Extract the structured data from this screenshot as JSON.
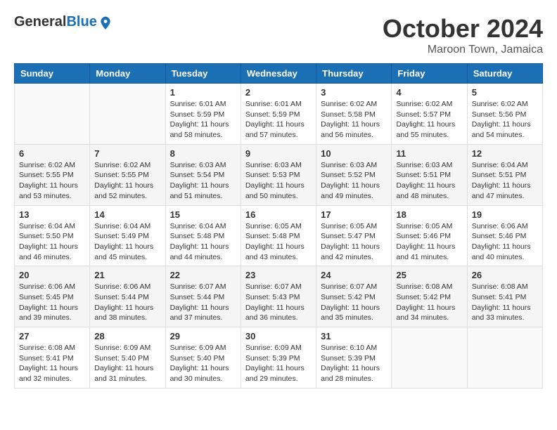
{
  "header": {
    "logo": {
      "general": "General",
      "blue": "Blue"
    },
    "month": "October 2024",
    "location": "Maroon Town, Jamaica"
  },
  "weekdays": [
    "Sunday",
    "Monday",
    "Tuesday",
    "Wednesday",
    "Thursday",
    "Friday",
    "Saturday"
  ],
  "weeks": [
    [
      {
        "day": "",
        "info": ""
      },
      {
        "day": "",
        "info": ""
      },
      {
        "day": "1",
        "info": "Sunrise: 6:01 AM\nSunset: 5:59 PM\nDaylight: 11 hours and 58 minutes."
      },
      {
        "day": "2",
        "info": "Sunrise: 6:01 AM\nSunset: 5:59 PM\nDaylight: 11 hours and 57 minutes."
      },
      {
        "day": "3",
        "info": "Sunrise: 6:02 AM\nSunset: 5:58 PM\nDaylight: 11 hours and 56 minutes."
      },
      {
        "day": "4",
        "info": "Sunrise: 6:02 AM\nSunset: 5:57 PM\nDaylight: 11 hours and 55 minutes."
      },
      {
        "day": "5",
        "info": "Sunrise: 6:02 AM\nSunset: 5:56 PM\nDaylight: 11 hours and 54 minutes."
      }
    ],
    [
      {
        "day": "6",
        "info": "Sunrise: 6:02 AM\nSunset: 5:55 PM\nDaylight: 11 hours and 53 minutes."
      },
      {
        "day": "7",
        "info": "Sunrise: 6:02 AM\nSunset: 5:55 PM\nDaylight: 11 hours and 52 minutes."
      },
      {
        "day": "8",
        "info": "Sunrise: 6:03 AM\nSunset: 5:54 PM\nDaylight: 11 hours and 51 minutes."
      },
      {
        "day": "9",
        "info": "Sunrise: 6:03 AM\nSunset: 5:53 PM\nDaylight: 11 hours and 50 minutes."
      },
      {
        "day": "10",
        "info": "Sunrise: 6:03 AM\nSunset: 5:52 PM\nDaylight: 11 hours and 49 minutes."
      },
      {
        "day": "11",
        "info": "Sunrise: 6:03 AM\nSunset: 5:51 PM\nDaylight: 11 hours and 48 minutes."
      },
      {
        "day": "12",
        "info": "Sunrise: 6:04 AM\nSunset: 5:51 PM\nDaylight: 11 hours and 47 minutes."
      }
    ],
    [
      {
        "day": "13",
        "info": "Sunrise: 6:04 AM\nSunset: 5:50 PM\nDaylight: 11 hours and 46 minutes."
      },
      {
        "day": "14",
        "info": "Sunrise: 6:04 AM\nSunset: 5:49 PM\nDaylight: 11 hours and 45 minutes."
      },
      {
        "day": "15",
        "info": "Sunrise: 6:04 AM\nSunset: 5:48 PM\nDaylight: 11 hours and 44 minutes."
      },
      {
        "day": "16",
        "info": "Sunrise: 6:05 AM\nSunset: 5:48 PM\nDaylight: 11 hours and 43 minutes."
      },
      {
        "day": "17",
        "info": "Sunrise: 6:05 AM\nSunset: 5:47 PM\nDaylight: 11 hours and 42 minutes."
      },
      {
        "day": "18",
        "info": "Sunrise: 6:05 AM\nSunset: 5:46 PM\nDaylight: 11 hours and 41 minutes."
      },
      {
        "day": "19",
        "info": "Sunrise: 6:06 AM\nSunset: 5:46 PM\nDaylight: 11 hours and 40 minutes."
      }
    ],
    [
      {
        "day": "20",
        "info": "Sunrise: 6:06 AM\nSunset: 5:45 PM\nDaylight: 11 hours and 39 minutes."
      },
      {
        "day": "21",
        "info": "Sunrise: 6:06 AM\nSunset: 5:44 PM\nDaylight: 11 hours and 38 minutes."
      },
      {
        "day": "22",
        "info": "Sunrise: 6:07 AM\nSunset: 5:44 PM\nDaylight: 11 hours and 37 minutes."
      },
      {
        "day": "23",
        "info": "Sunrise: 6:07 AM\nSunset: 5:43 PM\nDaylight: 11 hours and 36 minutes."
      },
      {
        "day": "24",
        "info": "Sunrise: 6:07 AM\nSunset: 5:42 PM\nDaylight: 11 hours and 35 minutes."
      },
      {
        "day": "25",
        "info": "Sunrise: 6:08 AM\nSunset: 5:42 PM\nDaylight: 11 hours and 34 minutes."
      },
      {
        "day": "26",
        "info": "Sunrise: 6:08 AM\nSunset: 5:41 PM\nDaylight: 11 hours and 33 minutes."
      }
    ],
    [
      {
        "day": "27",
        "info": "Sunrise: 6:08 AM\nSunset: 5:41 PM\nDaylight: 11 hours and 32 minutes."
      },
      {
        "day": "28",
        "info": "Sunrise: 6:09 AM\nSunset: 5:40 PM\nDaylight: 11 hours and 31 minutes."
      },
      {
        "day": "29",
        "info": "Sunrise: 6:09 AM\nSunset: 5:40 PM\nDaylight: 11 hours and 30 minutes."
      },
      {
        "day": "30",
        "info": "Sunrise: 6:09 AM\nSunset: 5:39 PM\nDaylight: 11 hours and 29 minutes."
      },
      {
        "day": "31",
        "info": "Sunrise: 6:10 AM\nSunset: 5:39 PM\nDaylight: 11 hours and 28 minutes."
      },
      {
        "day": "",
        "info": ""
      },
      {
        "day": "",
        "info": ""
      }
    ]
  ]
}
